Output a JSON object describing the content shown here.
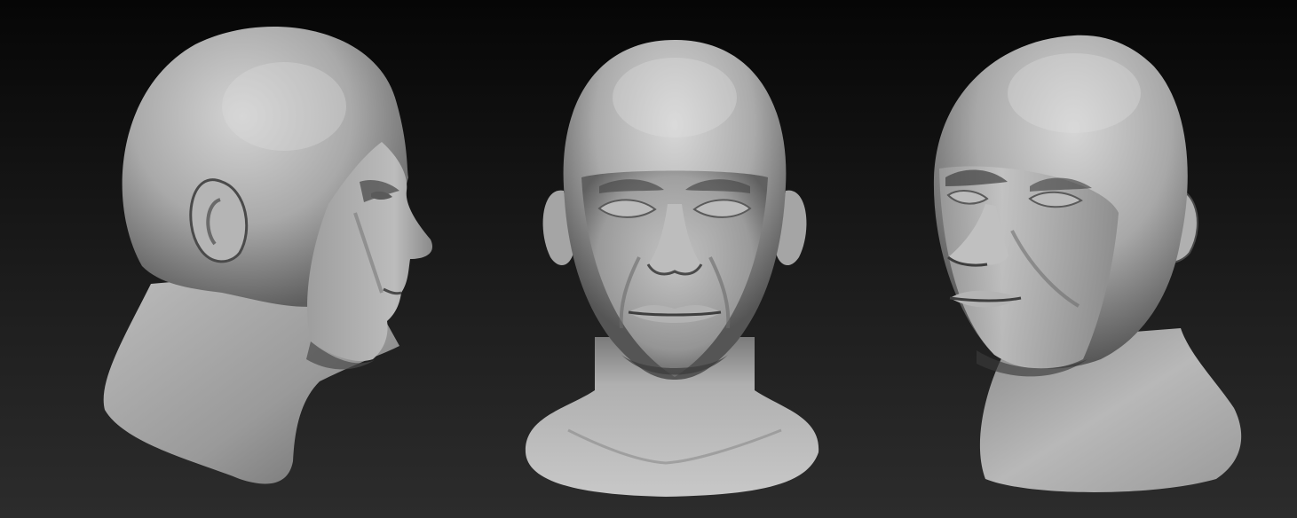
{
  "scene": {
    "background_top": "#060606",
    "background_bottom": "#2c2c2c",
    "material_color": "#b8b8b8",
    "views": [
      {
        "id": "left",
        "view": "right-profile"
      },
      {
        "id": "front",
        "view": "front"
      },
      {
        "id": "right",
        "view": "three-quarter-left"
      }
    ]
  }
}
